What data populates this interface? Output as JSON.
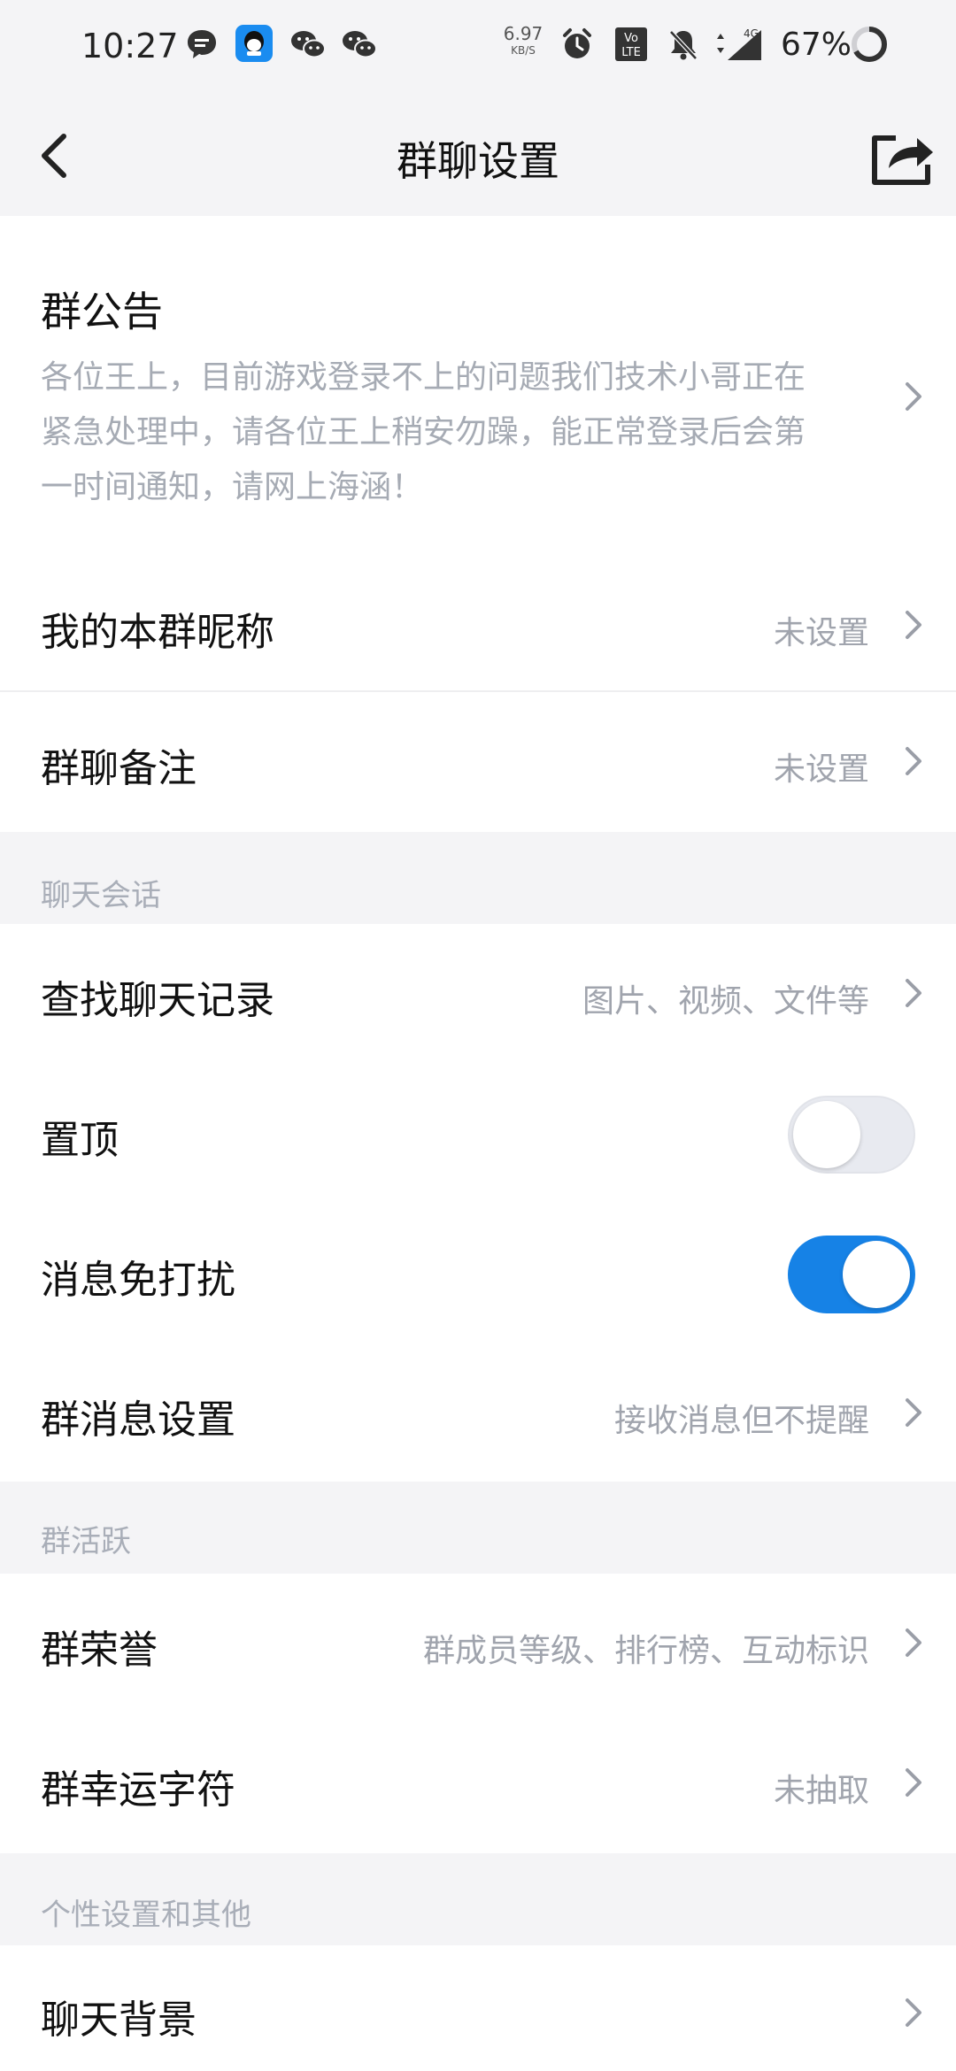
{
  "status_bar": {
    "time": "10:27",
    "speed_value": "6.97",
    "speed_unit": "KB/S",
    "network": "4G",
    "battery": "67%",
    "volte_label_top": "Vo",
    "volte_label_bottom": "LTE",
    "icons": [
      "message-bubble-icon",
      "qq-app-icon",
      "wechat-icon",
      "wechat-icon",
      "alarm-icon",
      "volte-icon",
      "mute-bell-icon",
      "signal-icon",
      "battery-ring-icon"
    ]
  },
  "nav": {
    "title": "群聊设置",
    "back_icon": "chevron-left-icon",
    "share_icon": "share-icon"
  },
  "notice": {
    "title": "群公告",
    "lines": [
      "各位王上，目前游戏登录不上的问题我们技术小哥正在",
      "紧急处理中，请各位王上稍安勿躁，能正常登录后会第",
      "一时间通知，请网上海涵！"
    ]
  },
  "group_info": {
    "nickname_label": "我的本群昵称",
    "nickname_value": "未设置",
    "remark_label": "群聊备注",
    "remark_value": "未设置"
  },
  "chat_session": {
    "header": "聊天会话",
    "search_label": "查找聊天记录",
    "search_value": "图片、视频、文件等",
    "pin_label": "置顶",
    "pin_on": false,
    "dnd_label": "消息免打扰",
    "dnd_on": true,
    "msg_settings_label": "群消息设置",
    "msg_settings_value": "接收消息但不提醒"
  },
  "group_activity": {
    "header": "群活跃",
    "honor_label": "群荣誉",
    "honor_value": "群成员等级、排行榜、互动标识",
    "lucky_label": "群幸运字符",
    "lucky_value": "未抽取"
  },
  "personal": {
    "header": "个性设置和其他",
    "background_label": "聊天背景"
  },
  "colors": {
    "accent": "#1682e6",
    "background": "#f4f4f6",
    "secondary_text": "#a0a4ad"
  }
}
